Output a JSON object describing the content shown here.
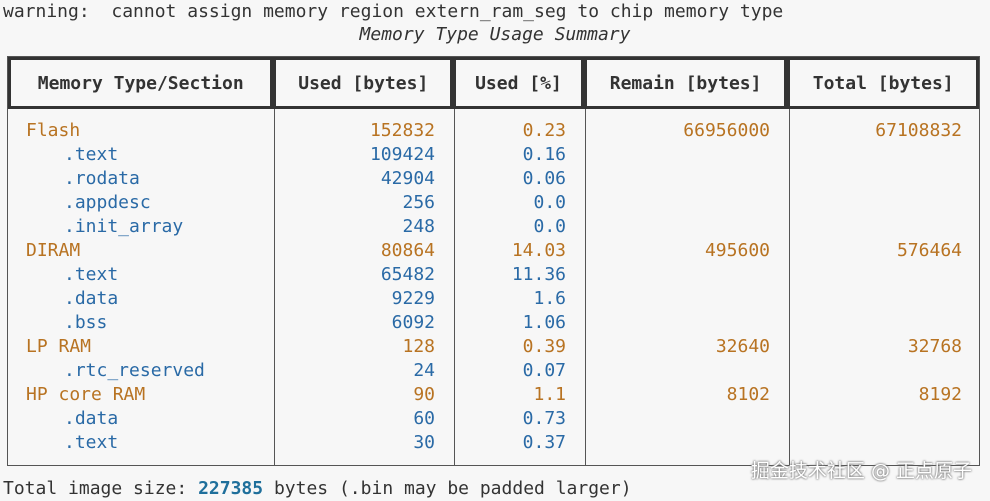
{
  "warning": "warning:  cannot assign memory region extern_ram_seg to chip memory type",
  "summary_title": "Memory Type Usage Summary",
  "headers": [
    "Memory Type/Section",
    "Used [bytes]",
    "Used [%]",
    "Remain [bytes]",
    "Total [bytes]"
  ],
  "rows": [
    {
      "kind": "mem",
      "name": "Flash",
      "used": "152832",
      "pct": "0.23",
      "remain": "66956000",
      "total": "67108832"
    },
    {
      "kind": "sec",
      "name": ".text",
      "used": "109424",
      "pct": "0.16",
      "remain": "",
      "total": ""
    },
    {
      "kind": "sec",
      "name": ".rodata",
      "used": "42904",
      "pct": "0.06",
      "remain": "",
      "total": ""
    },
    {
      "kind": "sec",
      "name": ".appdesc",
      "used": "256",
      "pct": "0.0",
      "remain": "",
      "total": ""
    },
    {
      "kind": "sec",
      "name": ".init_array",
      "used": "248",
      "pct": "0.0",
      "remain": "",
      "total": ""
    },
    {
      "kind": "mem",
      "name": "DIRAM",
      "used": "80864",
      "pct": "14.03",
      "remain": "495600",
      "total": "576464"
    },
    {
      "kind": "sec",
      "name": ".text",
      "used": "65482",
      "pct": "11.36",
      "remain": "",
      "total": ""
    },
    {
      "kind": "sec",
      "name": ".data",
      "used": "9229",
      "pct": "1.6",
      "remain": "",
      "total": ""
    },
    {
      "kind": "sec",
      "name": ".bss",
      "used": "6092",
      "pct": "1.06",
      "remain": "",
      "total": ""
    },
    {
      "kind": "mem",
      "name": "LP RAM",
      "used": "128",
      "pct": "0.39",
      "remain": "32640",
      "total": "32768"
    },
    {
      "kind": "sec",
      "name": ".rtc_reserved",
      "used": "24",
      "pct": "0.07",
      "remain": "",
      "total": ""
    },
    {
      "kind": "mem",
      "name": "HP core RAM",
      "used": "90",
      "pct": "1.1",
      "remain": "8102",
      "total": "8192"
    },
    {
      "kind": "sec",
      "name": ".data",
      "used": "60",
      "pct": "0.73",
      "remain": "",
      "total": ""
    },
    {
      "kind": "sec",
      "name": ".text",
      "used": "30",
      "pct": "0.37",
      "remain": "",
      "total": ""
    }
  ],
  "footer": {
    "prefix": "Total image size: ",
    "size": "227385",
    "suffix": " bytes (.bin may be padded larger)"
  },
  "watermark": "掘金技术社区 @ 正点原子",
  "colors": {
    "memory_type": "#b87322",
    "section": "#2a6aa6",
    "total_size": "#1f6f9b"
  }
}
